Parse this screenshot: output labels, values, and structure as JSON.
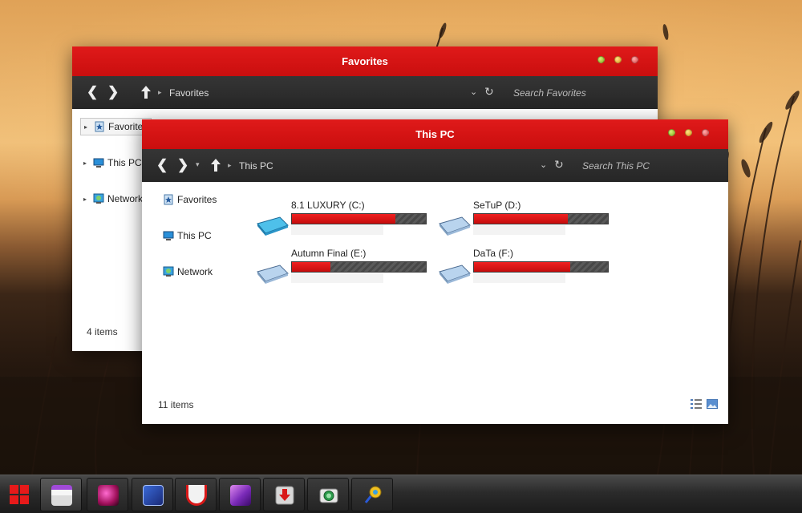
{
  "favorites_window": {
    "title": "Favorites",
    "breadcrumb": "Favorites",
    "search_placeholder": "Search Favorites",
    "nav_back": "❮",
    "nav_forward": "❯",
    "sidebar": [
      {
        "label": "Favorites",
        "icon": "favorites-star-icon"
      },
      {
        "label": "This PC",
        "icon": "computer-icon"
      },
      {
        "label": "Network",
        "icon": "network-icon"
      }
    ],
    "status": "4 items"
  },
  "thispc_window": {
    "title": "This PC",
    "breadcrumb": "This PC",
    "search_placeholder": "Search This PC",
    "nav_back": "❮",
    "nav_forward": "❯",
    "sidebar": [
      {
        "label": "Favorites",
        "icon": "favorites-star-icon"
      },
      {
        "label": "This PC",
        "icon": "computer-icon"
      },
      {
        "label": "Network",
        "icon": "network-icon"
      }
    ],
    "drives": [
      {
        "name": "8.1 LUXURY (C:)",
        "used_fraction": 0.77
      },
      {
        "name": "SeTuP (D:)",
        "used_fraction": 0.7
      },
      {
        "name": "Autumn Final (E:)",
        "used_fraction": 0.29
      },
      {
        "name": "DaTa (F:)",
        "used_fraction": 0.72
      }
    ],
    "status": "11 items"
  },
  "taskbar": {
    "items": [
      {
        "name": "start-button",
        "icon": "windows-logo-icon"
      },
      {
        "name": "file-explorer",
        "icon": "file-explorer-icon"
      },
      {
        "name": "app-2",
        "icon": "pink-feather-icon"
      },
      {
        "name": "app-3",
        "icon": "sparkle-wand-icon"
      },
      {
        "name": "app-4",
        "icon": "magnet-icon"
      },
      {
        "name": "app-5",
        "icon": "purple-folder-icon"
      },
      {
        "name": "app-6",
        "icon": "download-arrow-icon"
      },
      {
        "name": "app-7",
        "icon": "camera-icon"
      },
      {
        "name": "app-8",
        "icon": "pin-tool-icon"
      }
    ]
  },
  "colors": {
    "accent_red": "#d01414",
    "toolbar_dark": "#2c2c2c",
    "drive_fill": "#e01818",
    "drive_icon_blue": "#5fc8ec"
  }
}
